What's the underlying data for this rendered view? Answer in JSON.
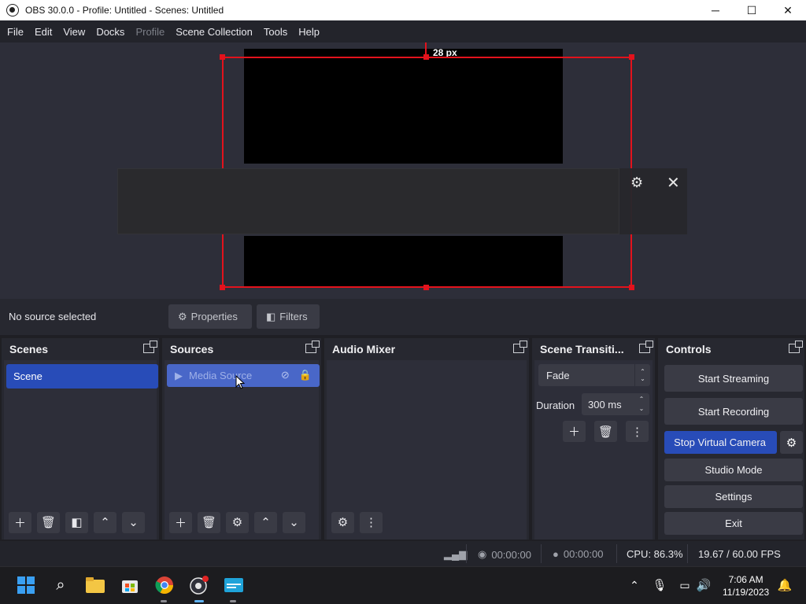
{
  "window": {
    "title": "OBS 30.0.0 - Profile: Untitled - Scenes: Untitled",
    "minimize": "─",
    "maximize": "☐",
    "close": "✕"
  },
  "menu": [
    "File",
    "Edit",
    "View",
    "Docks",
    "Profile",
    "Scene Collection",
    "Tools",
    "Help"
  ],
  "preview": {
    "guide_label": "28 px",
    "selection_color": "#e3121c"
  },
  "context": {
    "no_source": "No source selected",
    "properties": "Properties",
    "filters": "Filters"
  },
  "docks": {
    "scenes": {
      "title": "Scenes",
      "items": [
        "Scene"
      ]
    },
    "sources": {
      "title": "Sources",
      "items": [
        "Media Source"
      ]
    },
    "audio_mixer": {
      "title": "Audio Mixer"
    },
    "transitions": {
      "title": "Scene Transiti...",
      "selected": "Fade",
      "duration_label": "Duration",
      "duration_value": "300 ms"
    },
    "controls": {
      "title": "Controls",
      "start_streaming": "Start Streaming",
      "start_recording": "Start Recording",
      "stop_virtual_camera": "Stop Virtual Camera",
      "studio_mode": "Studio Mode",
      "settings": "Settings",
      "exit": "Exit"
    }
  },
  "status": {
    "stream_time": "00:00:00",
    "rec_time": "00:00:00",
    "cpu": "CPU: 86.3%",
    "fps": "19.67 / 60.00 FPS"
  },
  "taskbar": {
    "time": "7:06 AM",
    "date": "11/19/2023"
  },
  "colors": {
    "accent": "#284cb8",
    "panel": "#272830",
    "panel_body": "#2d2e39"
  }
}
